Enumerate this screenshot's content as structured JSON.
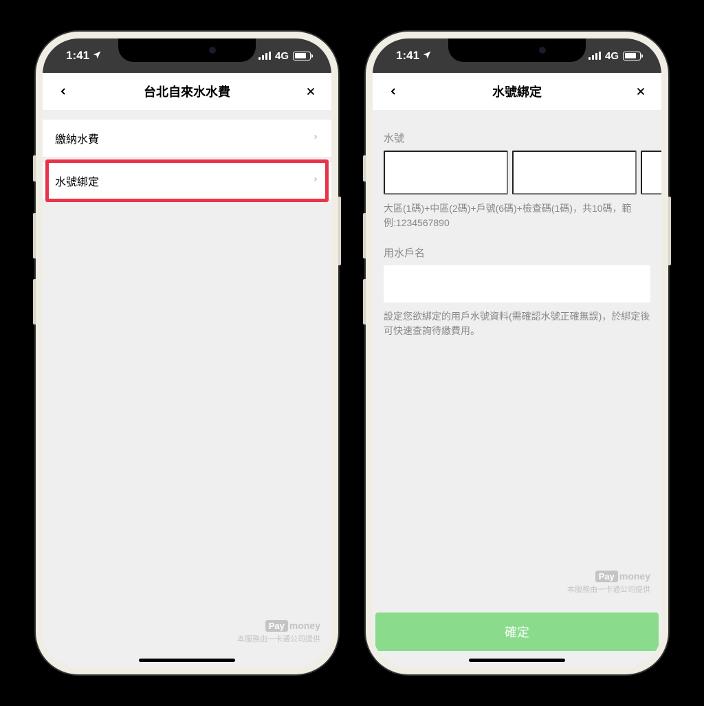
{
  "statusbar": {
    "time": "1:41",
    "network": "4G"
  },
  "screen1": {
    "title": "台北自來水水費",
    "menu": {
      "item1": "繳納水費",
      "item2": "水號綁定"
    }
  },
  "screen2": {
    "title": "水號綁定",
    "field1_label": "水號",
    "hint1": "大區(1碼)+中區(2碼)+戶號(6碼)+檢查碼(1碼)，共10碼，範例:1234567890",
    "field2_label": "用水戶名",
    "hint2": "設定您欲綁定的用戶水號資料(需確認水號正確無誤)，於綁定後可快速查詢待繳費用。",
    "confirm": "確定"
  },
  "footer": {
    "pay": "Pay",
    "money": "money",
    "provider": "本服務由一卡通公司提供"
  }
}
